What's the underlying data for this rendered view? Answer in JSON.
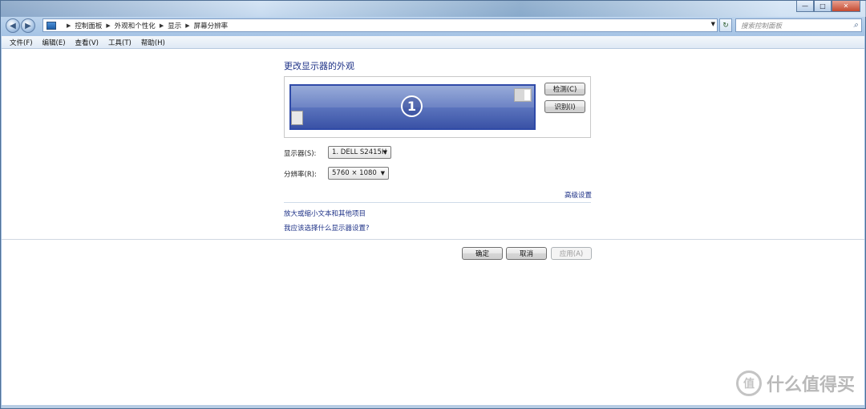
{
  "window": {
    "controls": {
      "minimize": "—",
      "maximize": "□",
      "close": "✕"
    }
  },
  "nav": {
    "back_icon": "back-arrow-icon",
    "forward_icon": "forward-arrow-icon",
    "breadcrumbs": [
      "控制面板",
      "外观和个性化",
      "显示",
      "屏幕分辨率"
    ],
    "search_placeholder": "搜索控制面板"
  },
  "menu": {
    "items": [
      "文件(F)",
      "编辑(E)",
      "查看(V)",
      "工具(T)",
      "帮助(H)"
    ]
  },
  "main": {
    "title": "更改显示器的外观",
    "monitor_number": "1",
    "detect_button": "检测(C)",
    "identify_button": "识别(I)",
    "display_label": "显示器(S):",
    "display_value": "1. DELL S2415H",
    "resolution_label": "分辨率(R):",
    "resolution_value": "5760 × 1080",
    "advanced_link": "高级设置",
    "link_text_size": "放大或缩小文本和其他项目",
    "link_which_settings": "我应该选择什么显示器设置?"
  },
  "footer": {
    "ok": "确定",
    "cancel": "取消",
    "apply": "应用(A)"
  },
  "watermark": {
    "logo": "值",
    "text": "什么值得买"
  },
  "colors": {
    "link": "#1e3287",
    "monitor": "#3a52a6"
  }
}
